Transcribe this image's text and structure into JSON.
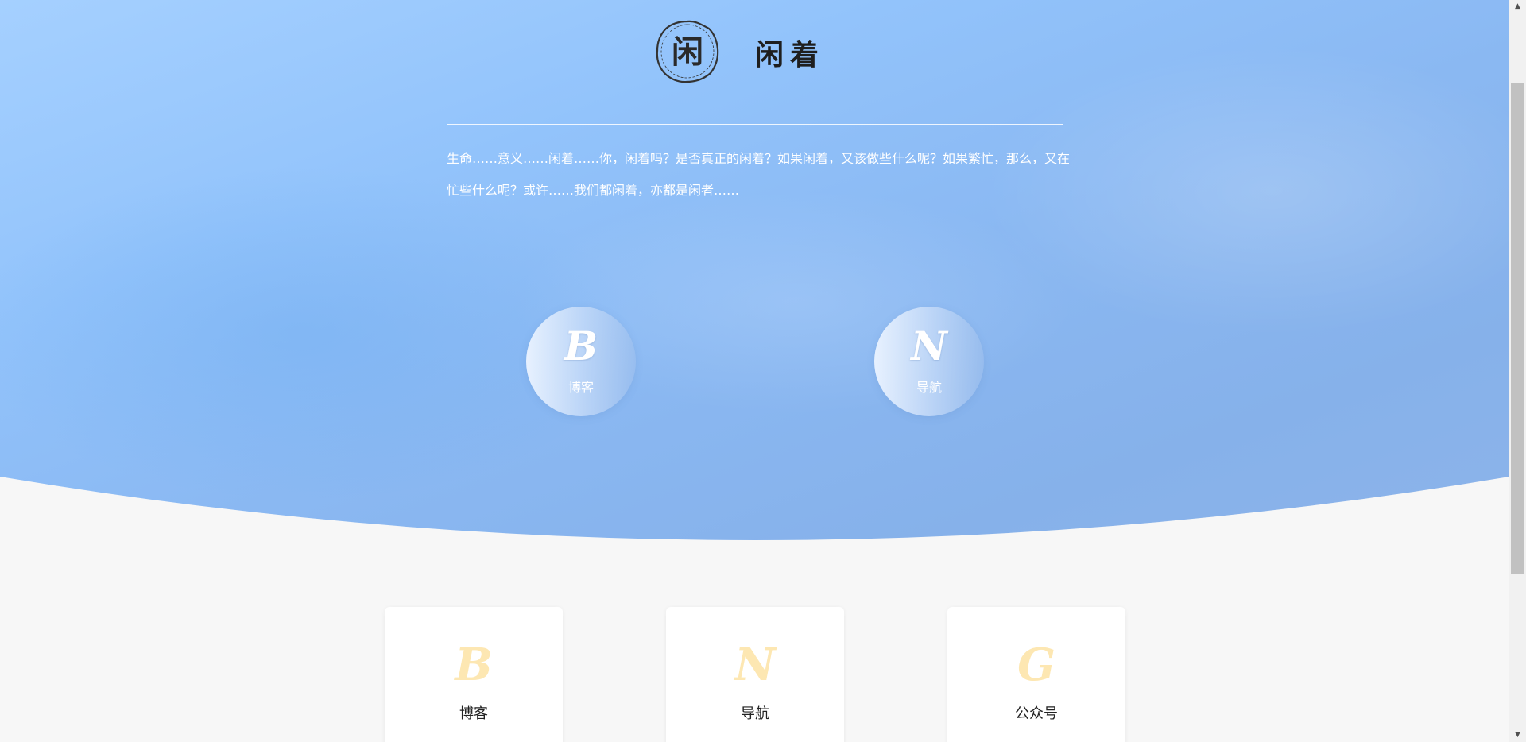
{
  "header": {
    "logo_icon": "seal-logo-icon",
    "logo_glyph": "闲",
    "title": "闲着"
  },
  "intro": {
    "text": "生命……意义……闲着……你，闲着吗？是否真正的闲着？如果闲着，又该做些什么呢？如果繁忙，那么，又在忙些什么呢？或许……我们都闲着，亦都是闲者……"
  },
  "hero_links": [
    {
      "glyph": "B",
      "label": "博客"
    },
    {
      "glyph": "N",
      "label": "导航"
    }
  ],
  "cards": [
    {
      "glyph": "B",
      "label": "博客"
    },
    {
      "glyph": "N",
      "label": "导航"
    },
    {
      "glyph": "G",
      "label": "公众号"
    }
  ],
  "scrollbar": {
    "up_icon": "▲",
    "down_icon": "▼"
  },
  "colors": {
    "hero_blue": "#92c3fb",
    "card_glyph": "#fde7b2",
    "page_bg": "#f7f7f7"
  }
}
